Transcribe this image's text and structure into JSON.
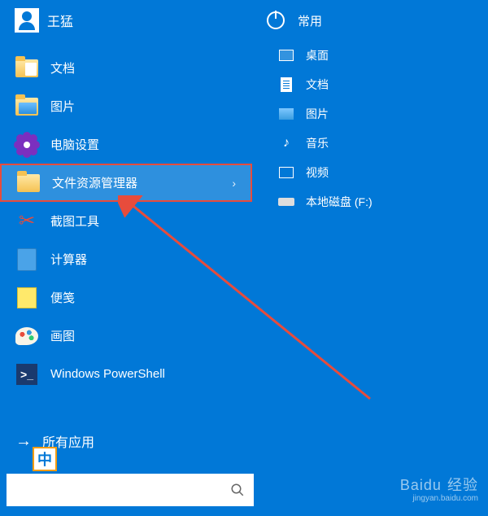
{
  "user": {
    "name": "王猛"
  },
  "left_menu": [
    {
      "label": "文档",
      "icon": "documents-folder-icon"
    },
    {
      "label": "图片",
      "icon": "pictures-folder-icon"
    },
    {
      "label": "电脑设置",
      "icon": "settings-gear-icon"
    },
    {
      "label": "文件资源管理器",
      "icon": "file-explorer-icon",
      "highlighted": true,
      "has_submenu": true
    },
    {
      "label": "截图工具",
      "icon": "snipping-tool-icon"
    },
    {
      "label": "计算器",
      "icon": "calculator-icon"
    },
    {
      "label": "便笺",
      "icon": "sticky-notes-icon"
    },
    {
      "label": "画图",
      "icon": "paint-icon"
    },
    {
      "label": "Windows PowerShell",
      "icon": "powershell-icon"
    }
  ],
  "all_apps_label": "所有应用",
  "right_header": "常用",
  "right_items": [
    {
      "label": "桌面",
      "icon": "desktop-icon"
    },
    {
      "label": "文档",
      "icon": "document-icon"
    },
    {
      "label": "图片",
      "icon": "picture-icon"
    },
    {
      "label": "音乐",
      "icon": "music-icon"
    },
    {
      "label": "视频",
      "icon": "video-icon"
    },
    {
      "label": "本地磁盘 (F:)",
      "icon": "disk-icon"
    }
  ],
  "ime_indicator": "中",
  "search": {
    "placeholder": ""
  },
  "watermark": {
    "brand": "Baidu",
    "suffix": "经验",
    "url": "jingyan.baidu.com"
  }
}
